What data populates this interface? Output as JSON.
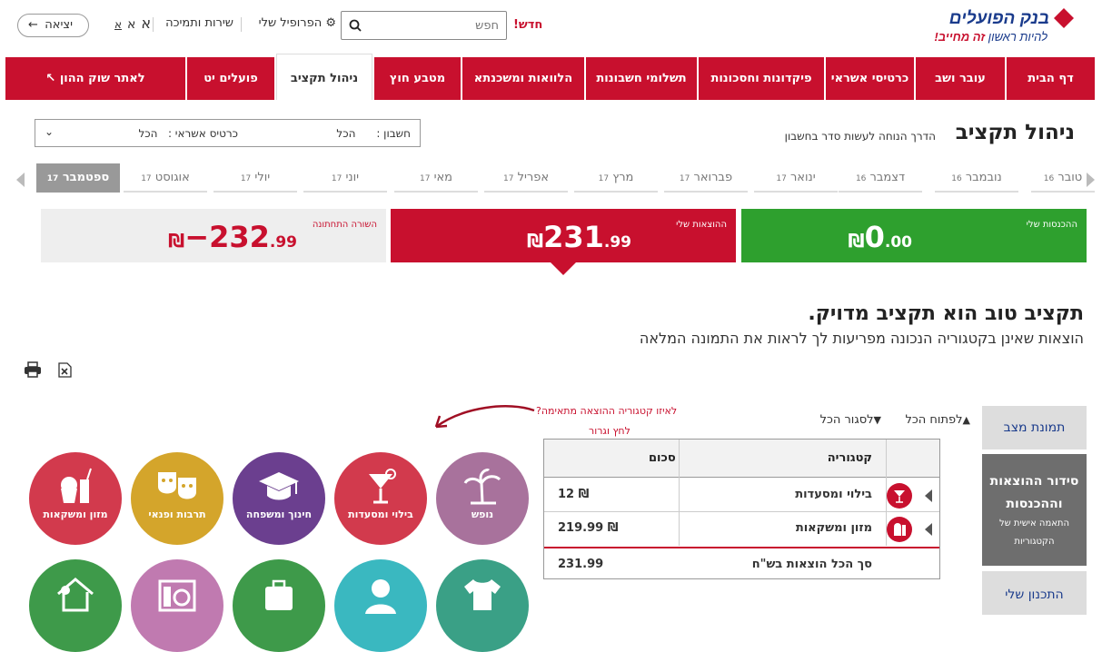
{
  "header": {
    "bank_name": "בנק הפועלים",
    "slogan_prefix": "להיות ראשון ",
    "slogan_bold": "זה מחייב!",
    "new_label": "חדש!",
    "search_placeholder": "חפש",
    "my_profile": "הפרופיל שלי",
    "service": "שירות ותמיכה",
    "font_sizes": [
      "א",
      "א",
      "א"
    ],
    "exit": "יציאה"
  },
  "mainnav": {
    "items": [
      "דף הבית",
      "עובר ושב",
      "כרטיסי אשראי",
      "פיקדונות וחסכונות",
      "תשלומי חשבונות",
      "הלוואות ומשכנתא",
      "מטבע חוץ",
      "ניהול תקציב",
      "פועלים יט",
      "לאתר שוק ההון"
    ],
    "active_index": 7
  },
  "page": {
    "title": "ניהול תקציב",
    "subtitle": "הדרך הנוחה לעשות סדר בחשבון"
  },
  "filter": {
    "account_label": "חשבון :",
    "account_value": "הכל",
    "cards_label": "כרטיס אשראי :",
    "cards_value": "הכל"
  },
  "months": [
    {
      "name": "טובר",
      "year": "16"
    },
    {
      "name": "נובמבר",
      "year": "16"
    },
    {
      "name": "דצמבר",
      "year": "16"
    },
    {
      "name": "ינואר",
      "year": "17"
    },
    {
      "name": "פברואר",
      "year": "17"
    },
    {
      "name": "מרץ",
      "year": "17"
    },
    {
      "name": "אפריל",
      "year": "17"
    },
    {
      "name": "מאי",
      "year": "17"
    },
    {
      "name": "יוני",
      "year": "17"
    },
    {
      "name": "יולי",
      "year": "17"
    },
    {
      "name": "אוגוסט",
      "year": "17"
    },
    {
      "name": "ספטמבר",
      "year": "17"
    }
  ],
  "summary": {
    "income_label": "ההכנסות שלי",
    "income_int": "0",
    "income_dec": ".00",
    "expense_label": "ההוצאות שלי",
    "expense_int": "231",
    "expense_dec": ".99",
    "balance_label": "השורה התחתונה",
    "balance_int": "−232",
    "balance_dec": ".99",
    "currency": "₪"
  },
  "headline": "תקציב טוב הוא תקציב מדויק.",
  "subline": "הוצאות שאינן בקטגוריה הנכונה מפריעות לך לראות את התמונה המלאה",
  "sidebar": {
    "status": "תמונת מצב",
    "arrange_title_1": "סידור ההוצאות",
    "arrange_title_2": "וההכנסות",
    "arrange_sub_1": "התאמה אישית של",
    "arrange_sub_2": "הקטגוריות",
    "plan": "התכנון שלי"
  },
  "controls": {
    "expand_all": "לפתוח הכל",
    "collapse_all": "לסגור הכל"
  },
  "table": {
    "col_category": "קטגוריה",
    "col_amount": "סכום",
    "rows": [
      {
        "category": "בילוי ומסעדות",
        "amount": "12 ₪"
      },
      {
        "category": "מזון ומשקאות",
        "amount": "219.99 ₪"
      }
    ],
    "total_label": "סך הכל הוצאות בש\"ח",
    "total_value": "231.99"
  },
  "hint": {
    "question": "לאיזו קטגוריה ההוצאה מתאימה?",
    "action": "לחץ וגרור"
  },
  "categories": [
    {
      "label": "נופש",
      "color": "#a8729c",
      "icon": "palm-tree-icon"
    },
    {
      "label": "בילוי ומסעדות",
      "color": "#d23a4d",
      "icon": "cocktail-icon"
    },
    {
      "label": "חינוך ומשפחה",
      "color": "#6b3f8f",
      "icon": "graduation-cap-icon"
    },
    {
      "label": "תרבות ופנאי",
      "color": "#d4a52b",
      "icon": "theater-masks-icon"
    },
    {
      "label": "מזון ומשקאות",
      "color": "#d23a4d",
      "icon": "cupcake-drink-icon"
    }
  ],
  "categories_row2": [
    {
      "color": "#3aa086",
      "icon": "tshirt-icon"
    },
    {
      "color": "#3ab8c0",
      "icon": "woman-icon"
    },
    {
      "color": "#3e9a4a",
      "icon": "suitcase-icon"
    },
    {
      "color": "#c07ab0",
      "icon": "appliances-icon"
    },
    {
      "color": "#3e9a4a",
      "icon": "house-icon"
    }
  ]
}
